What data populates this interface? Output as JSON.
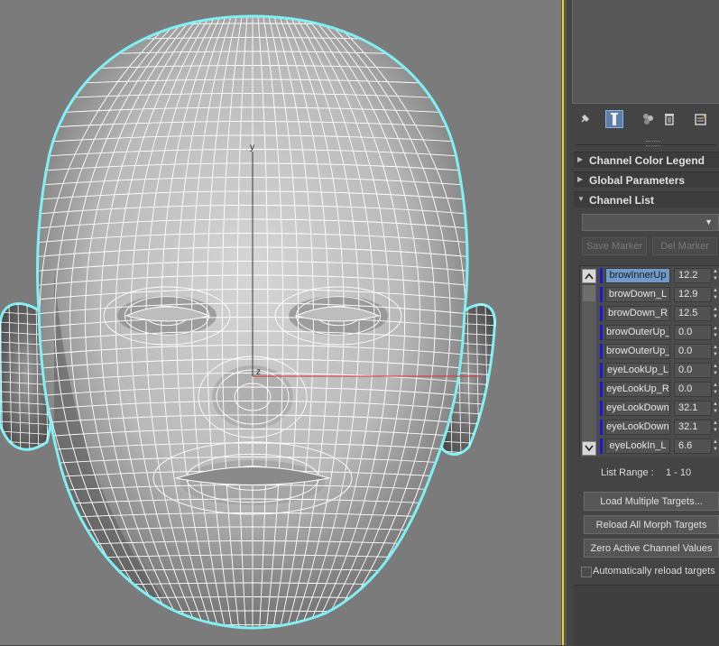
{
  "viewport": {
    "axis_y_label": "y",
    "axis_z_label": "z",
    "colors": {
      "background": "#7b7b7b",
      "mesh_outline": "#7ff0f4",
      "wire": "#ffffff",
      "x_axis": "#d23030"
    }
  },
  "toolbar": {
    "icons": [
      "pin-icon",
      "modifier-stack-icon",
      "show-end-result-icon",
      "delete-icon",
      "configure-sets-icon"
    ]
  },
  "rollouts": {
    "color_legend": "Channel Color Legend",
    "global_params": "Global Parameters",
    "channel_list": "Channel List"
  },
  "markers": {
    "dropdown_value": "",
    "save_label": "Save Marker",
    "del_label": "Del Marker"
  },
  "channels": [
    {
      "name": "browInnerUp",
      "value": "12.2",
      "selected": true
    },
    {
      "name": "browDown_L",
      "value": "12.9"
    },
    {
      "name": "browDown_R",
      "value": "12.5"
    },
    {
      "name": "browOuterUp_L",
      "value": "0.0"
    },
    {
      "name": "browOuterUp_R",
      "value": "0.0"
    },
    {
      "name": "eyeLookUp_L",
      "value": "0.0"
    },
    {
      "name": "eyeLookUp_R",
      "value": "0.0"
    },
    {
      "name": "eyeLookDown_L",
      "value": "32.1"
    },
    {
      "name": "eyeLookDown_R",
      "value": "32.1"
    },
    {
      "name": "eyeLookIn_L",
      "value": "6.6"
    }
  ],
  "list_range": {
    "label": "List Range :",
    "value": "1 - 10"
  },
  "buttons": {
    "load_multiple": "Load Multiple Targets...",
    "reload_all": "Reload All Morph Targets",
    "zero_active": "Zero Active Channel Values"
  },
  "auto_reload": {
    "label": "Automatically reload targets",
    "checked": false
  },
  "colors": {
    "panel_bg": "#444444",
    "selection": "#6f9ac9",
    "channel_marker": "#1a1ad0",
    "viewport_border": "#e8d21a"
  }
}
